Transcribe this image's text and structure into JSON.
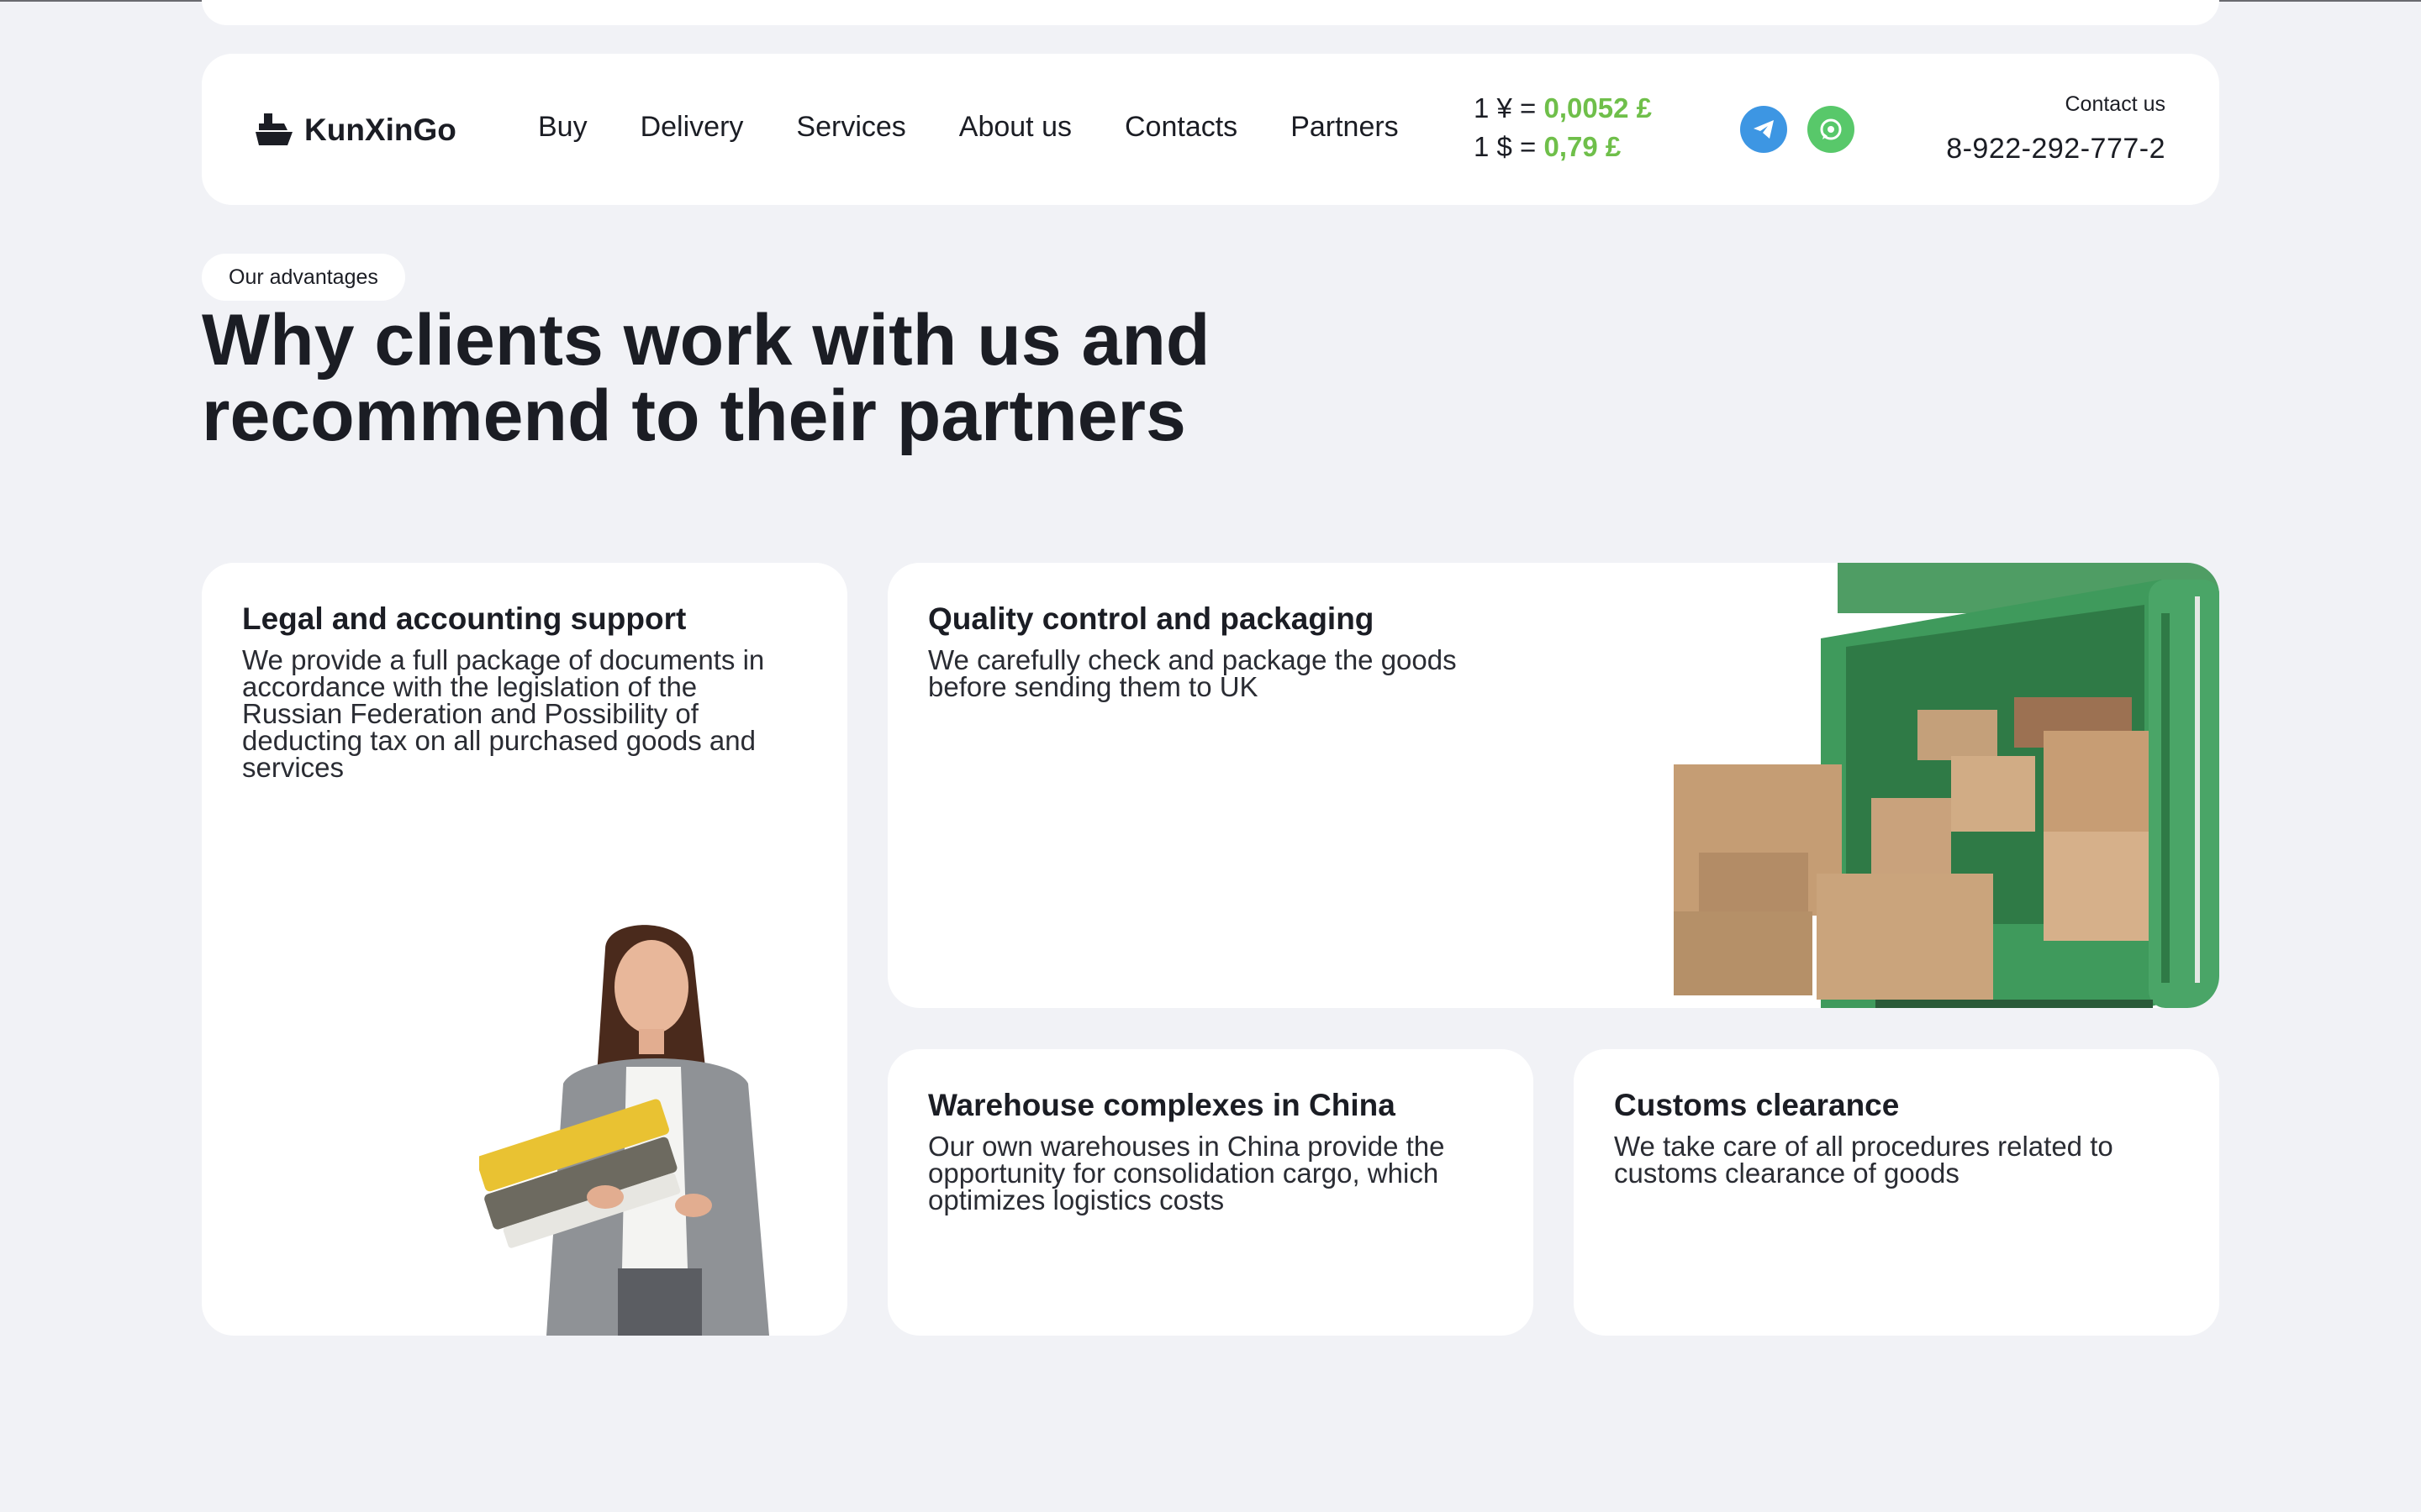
{
  "header": {
    "logo_text": "KunXinGo",
    "nav": [
      "Buy",
      "Delivery",
      "Services",
      "About us",
      "Contacts",
      "Partners"
    ],
    "rates": [
      {
        "prefix": "1 ¥ = ",
        "value": "0,0052 £"
      },
      {
        "prefix": "1 $ = ",
        "value": "0,79 £"
      }
    ],
    "contact_label": "Contact us",
    "phone": "8-922-292-777-2"
  },
  "section": {
    "badge": "Our advantages",
    "title": "Why clients work with us and recommend to their partners"
  },
  "cards": [
    {
      "title": "Legal and accounting support",
      "text": "We provide a full package of documents in accordance with the legislation of the Russian Federation and Possibility of deducting tax on all purchased goods and services"
    },
    {
      "title": "Quality control and packaging",
      "text": "We carefully check and package the goods before sending them to UK"
    },
    {
      "title": "Warehouse complexes in China",
      "text": "Our own warehouses in China provide the opportunity for consolidation cargo, which optimizes logistics costs"
    },
    {
      "title": "Customs clearance",
      "text": "We take care of all procedures related to customs clearance of goods"
    }
  ],
  "colors": {
    "page_bg": "#f1f2f6",
    "accent_green": "#6fbf4a",
    "telegram": "#3d96e3",
    "whatsapp": "#58c86a",
    "container_green": "#3f9a5c"
  },
  "icons": [
    "ship-logo-icon",
    "telegram-icon",
    "whatsapp-icon"
  ]
}
